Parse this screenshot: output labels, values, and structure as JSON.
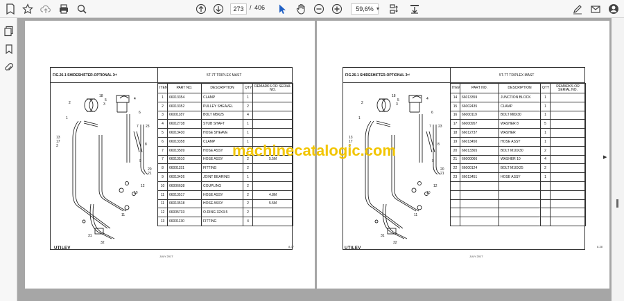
{
  "toolbar": {
    "current_page": "273",
    "page_sep": "/",
    "total_pages": "406",
    "zoom": "59,6%"
  },
  "watermark": "machinecatalogic.com",
  "left": {
    "fig_title": "FIG.26-1 SHIDESHIFTER-OPTIONAL 3ʳᵈ",
    "mast": "5T-7T  TRIPLEX MAST",
    "headers": [
      "ITEM",
      "PART NO.",
      "DESCRIPTION",
      "QTY",
      "REMARKS OR SERIAL NO."
    ],
    "rows": [
      [
        "1",
        "66013354",
        "CLAMP",
        "1",
        ""
      ],
      [
        "2",
        "66013352",
        "PULLEY SHEAVEL",
        "2",
        ""
      ],
      [
        "3",
        "66001187",
        "BOLT M8X25",
        "4",
        ""
      ],
      [
        "4",
        "66012738",
        "STUB SHAFT",
        "1",
        ""
      ],
      [
        "5",
        "66013430",
        "HOSE SHEAVE",
        "1",
        ""
      ],
      [
        "6",
        "66013358",
        "CLAMP",
        "1",
        ""
      ],
      [
        "7",
        "66013509",
        "HOSE ASSY",
        "2",
        ""
      ],
      [
        "7",
        "66013510",
        "HOSE ASSY",
        "2",
        "5.5M"
      ],
      [
        "8",
        "66001151",
        "FITTING",
        "2",
        ""
      ],
      [
        "9",
        "66013426",
        "JOINT BEARING",
        "1",
        ""
      ],
      [
        "10",
        "66006638",
        "COUPLING",
        "2",
        ""
      ],
      [
        "11",
        "66013517",
        "HOSE ASSY",
        "2",
        "4.8M"
      ],
      [
        "11",
        "66013518",
        "HOSE ASSY",
        "2",
        "5.5M"
      ],
      [
        "12",
        "66005733",
        "O-RING 32X3.5",
        "2",
        ""
      ],
      [
        "13",
        "66001130",
        "FITTING",
        "4",
        ""
      ]
    ],
    "logo": "UTILEV",
    "date": "JULY 2017",
    "page_no": "8-37",
    "callouts": [
      "2",
      "18",
      "5",
      "3",
      "4",
      "6",
      "1",
      "7",
      "23",
      "8",
      "13",
      "17",
      "3",
      "9",
      "20",
      "21",
      "10",
      "11",
      "12",
      "31",
      "32"
    ]
  },
  "right": {
    "fig_title": "FIG.26-1 SHIDESHIFTER-OPTIONAL 3ʳᵈ",
    "mast": "5T-7T  TRIPLEX MAST",
    "headers": [
      "ITEM",
      "PART NO.",
      "DESCRIPTION",
      "QTY",
      "REMARKS OR SERIAL NO."
    ],
    "rows": [
      [
        "14",
        "66013359",
        "JUNCTION BLOCK",
        "1",
        ""
      ],
      [
        "15",
        "66002435",
        "CLAMP",
        "1",
        ""
      ],
      [
        "16",
        "66000119",
        "BOLT M8X30",
        "1",
        ""
      ],
      [
        "17",
        "66000957",
        "WASHER 8",
        "5",
        ""
      ],
      [
        "18",
        "66012737",
        "WASHER",
        "1",
        ""
      ],
      [
        "19",
        "66013450",
        "HOSE ASSY",
        "1",
        ""
      ],
      [
        "20",
        "66013365",
        "BOLT M10X30",
        "2",
        ""
      ],
      [
        "21",
        "66000066",
        "WASHER 10",
        "4",
        ""
      ],
      [
        "22",
        "66000124",
        "BOLT M10X25",
        "2",
        ""
      ],
      [
        "23",
        "66013451",
        "HOSE ASSY",
        "1",
        ""
      ],
      [
        "",
        "",
        "",
        "",
        ""
      ],
      [
        "",
        "",
        "",
        "",
        ""
      ],
      [
        "",
        "",
        "",
        "",
        ""
      ],
      [
        "",
        "",
        "",
        "",
        ""
      ],
      [
        "",
        "",
        "",
        "",
        ""
      ]
    ],
    "logo": "UTILEV",
    "date": "JULY 2017",
    "page_no": "8-38",
    "callouts": [
      "2",
      "18",
      "5",
      "3",
      "4",
      "6",
      "1",
      "7",
      "23",
      "8",
      "13",
      "17",
      "3",
      "9",
      "20",
      "21",
      "10",
      "11",
      "12",
      "31",
      "32"
    ]
  }
}
